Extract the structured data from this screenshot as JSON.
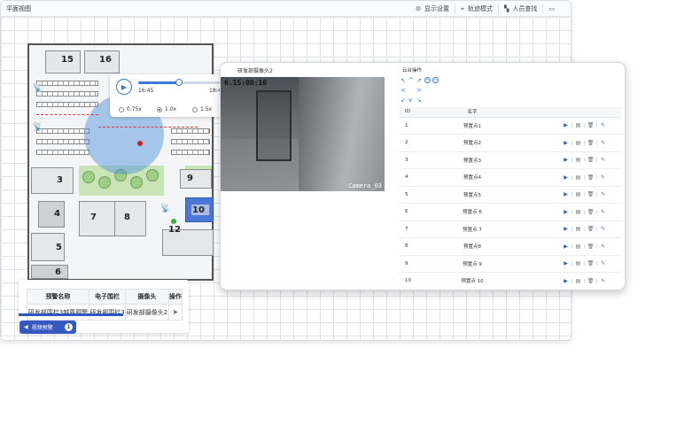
{
  "window": {
    "title": "平面视图",
    "toolbar": [
      {
        "icon": "gear-icon",
        "label": "显示设置"
      },
      {
        "icon": "location-icon",
        "label": "轨迹模式"
      },
      {
        "icon": "map-icon",
        "label": "人员查找"
      },
      {
        "icon": "fold-map-icon",
        "label": ""
      }
    ]
  },
  "floorplan": {
    "rooms": [
      "15",
      "16",
      "3",
      "4",
      "5",
      "6",
      "7",
      "8",
      "9",
      "10",
      "12"
    ]
  },
  "playback": {
    "start_time": "16:45",
    "end_time": "18:45",
    "progress_fraction": 0.48,
    "speeds": [
      {
        "label": "0.75x",
        "selected": false
      },
      {
        "label": "1.0x",
        "selected": true
      },
      {
        "label": "1.5x",
        "selected": false
      }
    ]
  },
  "alarm_table": {
    "headers": [
      "预警名称",
      "电子围栏",
      "摄像头",
      "操作"
    ],
    "rows": [
      [
        "研发部围栏3越界预警",
        "研发部围栏3",
        "研发部摄像头2",
        "navigate-icon"
      ]
    ]
  },
  "video_button": {
    "label": "视频预警",
    "count": "1"
  },
  "video_popup": {
    "title": "研发部摄像头2",
    "timestamp": "6.15:00:16",
    "camera_label": "Camera_03",
    "ptz_title": "云台操作",
    "preset_headers": [
      "ID",
      "名字",
      ""
    ],
    "presets": [
      {
        "id": "1",
        "name": "预置点1"
      },
      {
        "id": "2",
        "name": "预置点2"
      },
      {
        "id": "3",
        "name": "预置点3"
      },
      {
        "id": "4",
        "name": "预置点4"
      },
      {
        "id": "5",
        "name": "预置点5"
      },
      {
        "id": "6",
        "name": "预置点 6"
      },
      {
        "id": "7",
        "name": "预置点 7"
      },
      {
        "id": "8",
        "name": "预置点8"
      },
      {
        "id": "9",
        "name": "预置点 9"
      },
      {
        "id": "10",
        "name": "预置点 10"
      }
    ],
    "preset_actions": [
      "play-icon",
      "save-icon",
      "delete-icon",
      "edit-icon"
    ]
  },
  "colors": {
    "accent": "#3a78d6",
    "button_blue": "#3559c0",
    "alarm_red": "#d0201b",
    "coverage": "#468cdc"
  }
}
